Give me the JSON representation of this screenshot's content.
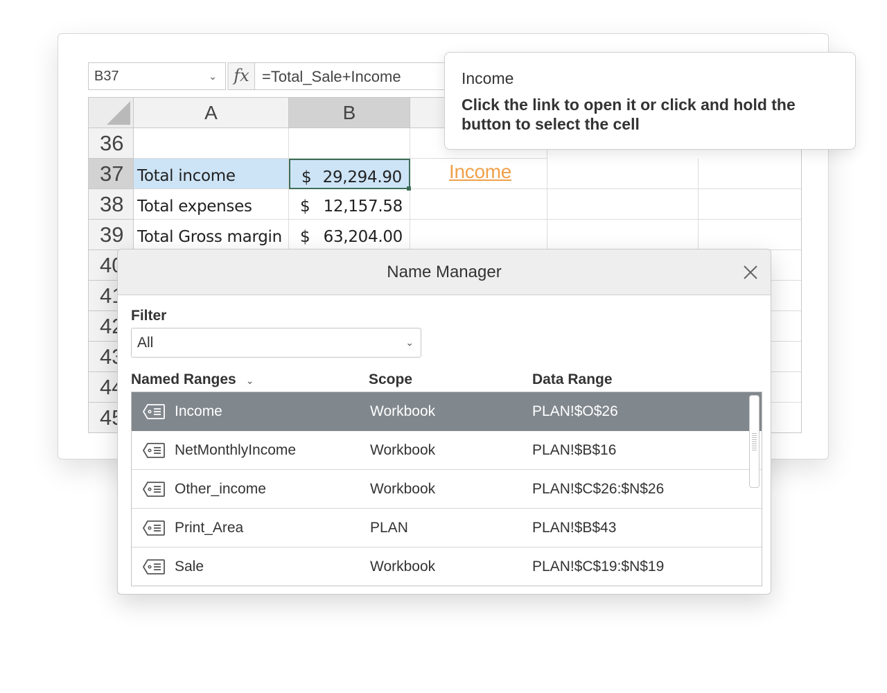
{
  "formula_bar": {
    "name_box": "B37",
    "fx_label": "fx",
    "formula": "=Total_Sale+Income"
  },
  "grid": {
    "columns": [
      "A",
      "B"
    ],
    "row_numbers": [
      "36",
      "37",
      "38",
      "39",
      "40",
      "41",
      "42",
      "43",
      "44",
      "45"
    ],
    "rows": [
      {
        "label": "",
        "dollar": "",
        "amount": ""
      },
      {
        "label": "Total income",
        "dollar": "$",
        "amount": "29,294.90"
      },
      {
        "label": "Total expenses",
        "dollar": "$",
        "amount": "12,157.58"
      },
      {
        "label": "Total Gross margin",
        "dollar": "$",
        "amount": "63,204.00"
      }
    ],
    "hyperlink": "Income"
  },
  "tooltip": {
    "title": "Income",
    "body": "Click the link to open it or click and hold the button to select the cell"
  },
  "name_manager": {
    "title": "Name Manager",
    "filter_label": "Filter",
    "filter_value": "All",
    "headers": {
      "name": "Named Ranges",
      "scope": "Scope",
      "range": "Data Range"
    },
    "rows": [
      {
        "name": "Income",
        "scope": "Workbook",
        "range": "PLAN!$O$26",
        "selected": true
      },
      {
        "name": "NetMonthlyIncome",
        "scope": "Workbook",
        "range": "PLAN!$B$16",
        "selected": false
      },
      {
        "name": "Other_income",
        "scope": "Workbook",
        "range": "PLAN!$C$26:$N$26",
        "selected": false
      },
      {
        "name": "Print_Area",
        "scope": "PLAN",
        "range": "PLAN!$B$43",
        "selected": false
      },
      {
        "name": "Sale",
        "scope": "Workbook",
        "range": "PLAN!$C$19:$N$19",
        "selected": false
      }
    ]
  },
  "colors": {
    "selected_row": "#80878d",
    "highlight": "#cde4f7",
    "active_border": "#3d6d57",
    "link": "#f0a04a"
  },
  "icons": {
    "name_box_dropdown": "chevron-down-icon",
    "close": "close-icon",
    "named_range": "named-range-tag-icon"
  }
}
